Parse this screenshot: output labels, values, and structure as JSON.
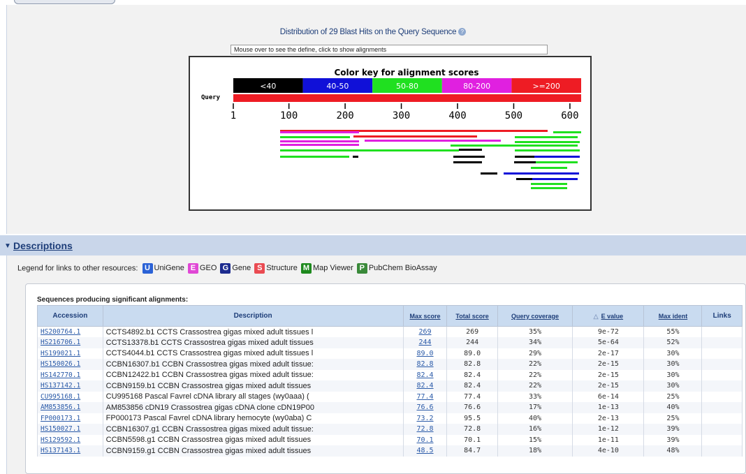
{
  "graph": {
    "title": "Distribution of 29 Blast Hits on the Query Sequence",
    "help_icon": "?",
    "hover_text": "Mouse over to see the define, click to show alignments",
    "color_key_title": "Color key for alignment scores",
    "score_bins": [
      {
        "label": "<40",
        "color": "#000000"
      },
      {
        "label": "40-50",
        "color": "#1010d8"
      },
      {
        "label": "50-80",
        "color": "#20e020"
      },
      {
        "label": "80-200",
        "color": "#e020e0"
      },
      {
        "label": ">=200",
        "color": "#ee1c24"
      }
    ],
    "query_label": "Query",
    "ticks": [
      "1",
      "100",
      "200",
      "300",
      "400",
      "500",
      "600"
    ]
  },
  "descriptions": {
    "title": "Descriptions",
    "legend_prefix": "Legend for links to other resources:",
    "legend_items": [
      {
        "icon_letter": "U",
        "label": "UniGene",
        "color": "#2b62d6"
      },
      {
        "icon_letter": "E",
        "label": "GEO",
        "color": "#e047d5"
      },
      {
        "icon_letter": "G",
        "label": "Gene",
        "color": "#1d2c8f"
      },
      {
        "icon_letter": "S",
        "label": "Structure",
        "color": "#ea4b52"
      },
      {
        "icon_letter": "M",
        "label": "Map Viewer",
        "color": "#1e8a1e"
      },
      {
        "icon_letter": "P",
        "label": "PubChem BioAssay",
        "color": "#3a8a3a"
      }
    ]
  },
  "table": {
    "caption": "Sequences producing significant alignments:",
    "headers": {
      "accession": "Accession",
      "description": "Description",
      "max_score": "Max score",
      "total_score": "Total score",
      "query_coverage": "Query coverage",
      "e_value": "E value",
      "max_ident": "Max ident",
      "links": "Links"
    },
    "rows": [
      {
        "acc": "HS200764.1",
        "desc": "CCTS4892.b1 CCTS Crassostrea gigas mixed adult tissues l",
        "max": "269",
        "total": "269",
        "cov": "35%",
        "e": "9e-72",
        "ident": "55%"
      },
      {
        "acc": "HS216706.1",
        "desc": "CCTS13378.b1 CCTS Crassostrea gigas mixed adult tissues",
        "max": "244",
        "total": "244",
        "cov": "34%",
        "e": "5e-64",
        "ident": "52%"
      },
      {
        "acc": "HS199021.1",
        "desc": "CCTS4044.b1 CCTS Crassostrea gigas mixed adult tissues l",
        "max": "89.0",
        "total": "89.0",
        "cov": "29%",
        "e": "2e-17",
        "ident": "30%"
      },
      {
        "acc": "HS150026.1",
        "desc": "CCBN16307.b1 CCBN Crassostrea gigas mixed adult tissue:",
        "max": "82.8",
        "total": "82.8",
        "cov": "22%",
        "e": "2e-15",
        "ident": "30%"
      },
      {
        "acc": "HS142770.1",
        "desc": "CCBN12422.b1 CCBN Crassostrea gigas mixed adult tissue:",
        "max": "82.4",
        "total": "82.4",
        "cov": "22%",
        "e": "2e-15",
        "ident": "30%"
      },
      {
        "acc": "HS137142.1",
        "desc": "CCBN9159.b1 CCBN Crassostrea gigas mixed adult tissues",
        "max": "82.4",
        "total": "82.4",
        "cov": "22%",
        "e": "2e-15",
        "ident": "30%"
      },
      {
        "acc": "CU995168.1",
        "desc": "CU995168 Pascal Favrel cDNA library all stages (wy0aaa) (",
        "max": "77.4",
        "total": "77.4",
        "cov": "33%",
        "e": "6e-14",
        "ident": "25%"
      },
      {
        "acc": "AM853856.1",
        "desc": "AM853856 cDN19 Crassostrea gigas cDNA clone cDN19P00",
        "max": "76.6",
        "total": "76.6",
        "cov": "17%",
        "e": "1e-13",
        "ident": "40%"
      },
      {
        "acc": "FP000173.1",
        "desc": "FP000173 Pascal Favrel cDNA library hemocyte (wy0aba) C",
        "max": "73.2",
        "total": "95.5",
        "cov": "40%",
        "e": "2e-13",
        "ident": "25%"
      },
      {
        "acc": "HS150027.1",
        "desc": "CCBN16307.g1 CCBN Crassostrea gigas mixed adult tissue:",
        "max": "72.8",
        "total": "72.8",
        "cov": "16%",
        "e": "1e-12",
        "ident": "39%"
      },
      {
        "acc": "HS129592.1",
        "desc": "CCBN5598.g1 CCBN Crassostrea gigas mixed adult tissues",
        "max": "70.1",
        "total": "70.1",
        "cov": "15%",
        "e": "1e-11",
        "ident": "39%"
      },
      {
        "acc": "HS137143.1",
        "desc": "CCBN9159.g1 CCBN Crassostrea gigas mixed adult tissues",
        "max": "48.5",
        "total": "84.7",
        "cov": "18%",
        "e": "4e-10",
        "ident": "48%"
      }
    ]
  }
}
